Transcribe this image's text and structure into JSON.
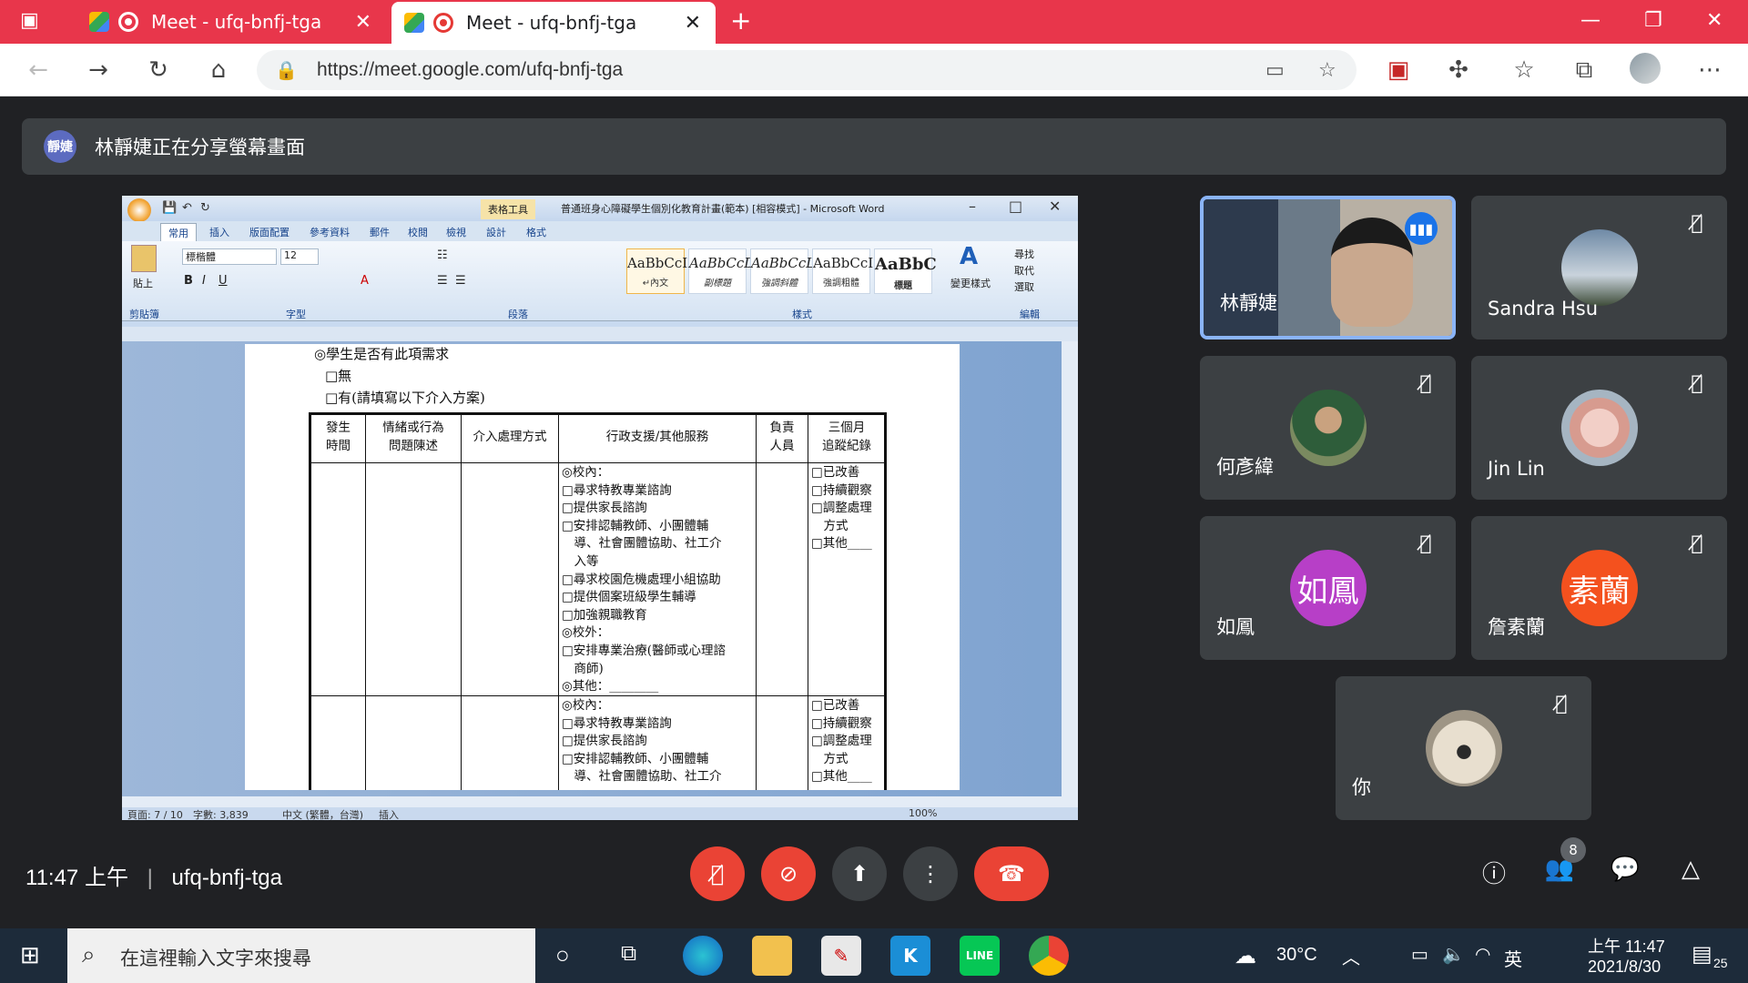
{
  "browser": {
    "tabs": [
      {
        "title": "Meet - ufq-bnfj-tga",
        "active": false
      },
      {
        "title": "Meet - ufq-bnfj-tga",
        "active": true
      }
    ],
    "url": "https://meet.google.com/ufq-bnfj-tga"
  },
  "banner": {
    "avatar_text": "靜婕",
    "text": "林靜婕正在分享螢幕畫面"
  },
  "word": {
    "title": "普通班身心障礙學生個別化教育計畫(範本) [相容模式] - Microsoft Word",
    "context_tab": "表格工具",
    "tabs": [
      "常用",
      "插入",
      "版面配置",
      "參考資料",
      "郵件",
      "校閱",
      "檢視",
      "設計",
      "格式"
    ],
    "ribbon": {
      "paste": "貼上",
      "font_name": "標楷體",
      "font_size": "12",
      "groups": [
        "剪貼簿",
        "字型",
        "段落",
        "樣式",
        "編輯"
      ],
      "styles": [
        {
          "sample": "AaBbCcI",
          "name": "↵內文"
        },
        {
          "sample": "AaBbCcD",
          "name": "副標題"
        },
        {
          "sample": "AaBbCcL",
          "name": "強調斜體"
        },
        {
          "sample": "AaBbCcI",
          "name": "強調粗體"
        },
        {
          "sample": "AaBbC",
          "name": "標題"
        }
      ],
      "change_style": "變更樣式",
      "edit_items": [
        "尋找",
        "取代",
        "選取"
      ]
    },
    "doc": {
      "question": "◎學生是否有此項需求",
      "opt_none": "□無",
      "opt_yes": "□有(請填寫以下介入方案)",
      "headers": [
        [
          "發生",
          "時間"
        ],
        [
          "情緒或行為",
          "問題陳述"
        ],
        [
          "介入處理方式"
        ],
        [
          "行政支援/其他服務"
        ],
        [
          "負責",
          "人員"
        ],
        [
          "三個月",
          "追蹤紀錄"
        ]
      ],
      "row1_support": [
        "◎校內：",
        "□尋求特教專業諮詢",
        "□提供家長諮詢",
        "□安排認輔教師、小團體輔",
        "　導、社會團體協助、社工介",
        "　入等",
        "□尋求校園危機處理小組協助",
        "□提供個案班級學生輔導",
        "□加強親職教育",
        "◎校外：",
        "□安排專業治療(醫師或心理諮",
        "　商師)",
        "◎其他：________"
      ],
      "row1_tracking": [
        "□已改善",
        "□持續觀察",
        "□調整處理",
        "　方式",
        "□其他____"
      ],
      "row2_support": [
        "◎校內：",
        "□尋求特教專業諮詢",
        "□提供家長諮詢",
        "□安排認輔教師、小團體輔",
        "　導、社會團體協助、社工介"
      ],
      "row2_tracking": [
        "□已改善",
        "□持續觀察",
        "□調整處理",
        "　方式",
        "□其他____"
      ]
    },
    "status": {
      "page": "頁面: 7 / 10",
      "words": "字數: 3,839",
      "lang": "中文 (繁體，台灣)",
      "mode": "插入",
      "zoom": "100%"
    }
  },
  "participants": [
    {
      "name": "林靜婕",
      "speaking": true
    },
    {
      "name": "Sandra Hsu",
      "muted": true
    },
    {
      "name": "何彥緯",
      "muted": true
    },
    {
      "name": "Jin Lin",
      "muted": true
    },
    {
      "name": "如鳳",
      "muted": true,
      "letter": "如鳳",
      "color": "#b73fc7"
    },
    {
      "name": "詹素蘭",
      "muted": true,
      "letter": "素蘭",
      "color": "#f4511e"
    },
    {
      "name": "你",
      "muted": true
    }
  ],
  "meeting": {
    "time": "11:47 上午",
    "code": "ufq-bnfj-tga",
    "people_count": "8"
  },
  "taskbar": {
    "search_placeholder": "在這裡輸入文字來搜尋",
    "weather": "30°C",
    "ime": "英",
    "time": "上午 11:47",
    "date": "2021/8/30",
    "notifications": "25"
  }
}
